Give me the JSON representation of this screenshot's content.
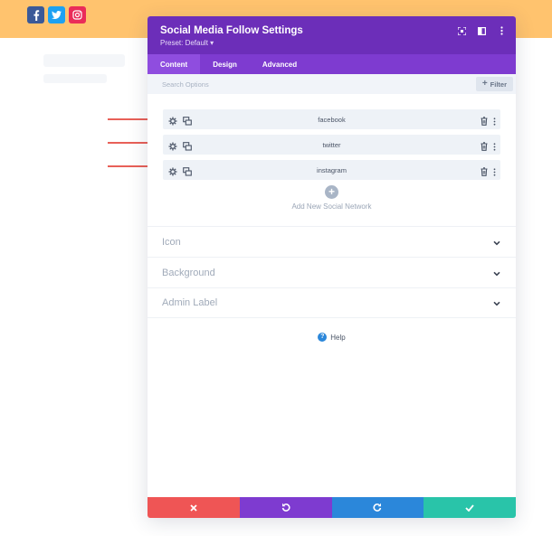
{
  "colors": {
    "banner": "#ffc36e",
    "header": "#6c2eb9",
    "tabs_bar": "#7e3bd0",
    "facebook": "#3b5998",
    "twitter": "#1da1f2",
    "instagram": "#ea2c59",
    "cancel": "#ef5555",
    "undo": "#7e3bd0",
    "redo": "#2b87da",
    "save": "#29c4a9",
    "arrow": "#e02b20"
  },
  "page_social_icons": [
    {
      "icon": "facebook-icon",
      "glyph": "f"
    },
    {
      "icon": "twitter-icon",
      "glyph": "t"
    },
    {
      "icon": "instagram-icon",
      "glyph": "ig"
    }
  ],
  "modal": {
    "title": "Social Media Follow Settings",
    "preset": "Preset: Default ▾",
    "header_tools": [
      "focus-icon",
      "sidebar-toggle-icon",
      "more-options-icon"
    ]
  },
  "tabs": [
    {
      "label": "Content",
      "active": true
    },
    {
      "label": "Design",
      "active": false
    },
    {
      "label": "Advanced",
      "active": false
    }
  ],
  "search": {
    "placeholder": "Search Options",
    "filter_label": "Filter"
  },
  "social_networks": [
    {
      "label": "facebook"
    },
    {
      "label": "twitter"
    },
    {
      "label": "instagram"
    }
  ],
  "add_new": {
    "label": "Add New Social Network"
  },
  "sections": [
    {
      "label": "Icon"
    },
    {
      "label": "Background"
    },
    {
      "label": "Admin Label"
    }
  ],
  "help": {
    "label": "Help"
  },
  "footer": [
    {
      "action": "cancel",
      "icon": "close-icon"
    },
    {
      "action": "undo",
      "icon": "undo-icon"
    },
    {
      "action": "redo",
      "icon": "redo-icon"
    },
    {
      "action": "save",
      "icon": "check-icon"
    }
  ]
}
